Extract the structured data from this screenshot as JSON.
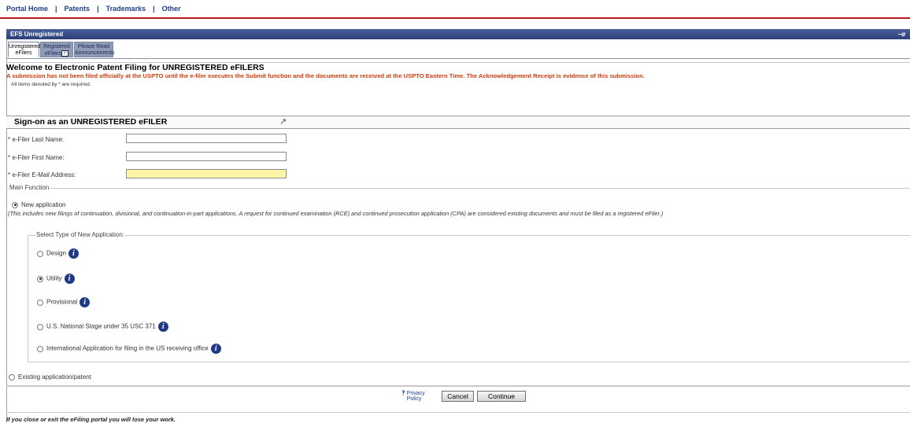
{
  "topnav": {
    "items": [
      "Portal Home",
      "Patents",
      "Trademarks",
      "Other"
    ],
    "separator": "|"
  },
  "window": {
    "title": "EFS Unregistered",
    "controls": "−ø"
  },
  "tabs": [
    {
      "line1": "Unregistered",
      "line2": "eFilers"
    },
    {
      "line1": "Registered",
      "line2": "eFilers"
    },
    {
      "line1": "Please Read",
      "line2": "Announcements"
    }
  ],
  "welcome_title": "Welcome to Electronic Patent Filing for UNREGISTERED eFILERS",
  "warning": "A submission has not been filed officially at the USPTO until the e-filer executes the Submit function and the documents are received at the USPTO Eastern Time. The Acknowledgement Receipt is evidence of this submission.",
  "required_note": "All items denoted by * are required.",
  "signon": {
    "title": "Sign-on as an UNREGISTERED eFILER",
    "fields": [
      {
        "label": "* e-Filer Last Name:",
        "value": ""
      },
      {
        "label": "* e-Filer First Name:",
        "value": ""
      },
      {
        "label": "* e-Filer E-Mail Address:",
        "value": ""
      }
    ]
  },
  "main_function": {
    "legend": "Main Function",
    "new_application": "New application",
    "new_application_selected": true,
    "note": "(This includes new filings of continuation, divisional, and continuation-in-part applications. A request for continued examination (RCE) and continued prosecution application (CPA) are considered existing documents and must be filed as a registered eFiler.)",
    "existing": "Existing application/patent",
    "existing_selected": false
  },
  "app_types": {
    "legend": "Select Type of New Application:",
    "options": [
      {
        "label": "Design",
        "selected": false
      },
      {
        "label": "Utility",
        "selected": true
      },
      {
        "label": "Provisional",
        "selected": false
      },
      {
        "label": "U.S. National Stage under 35 USC 371",
        "selected": false
      },
      {
        "label": "International Application for filing in the US receiving office",
        "selected": false
      }
    ]
  },
  "footer": {
    "privacy_line1": "Privacy",
    "privacy_line2": "Policy",
    "cancel": "Cancel",
    "continue": "Continue"
  },
  "bottom_text": "If you close or exit the eFiling portal you will lose your work.",
  "colors": {
    "title_bar": "#2b3e79",
    "warning": "#d13b0c",
    "email_highlight": "#fff5a6",
    "info_icon": "#1e3a86"
  }
}
